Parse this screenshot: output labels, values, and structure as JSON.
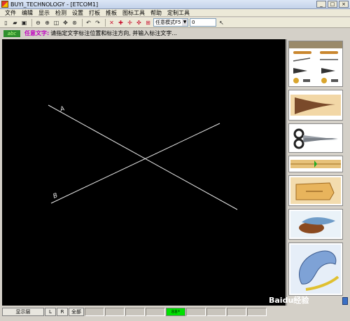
{
  "window": {
    "title": "BUYI_TECHNOLOGY - [ETCOM1]"
  },
  "menu": [
    "文件",
    "编辑",
    "显示",
    "检测",
    "设置",
    "打板",
    "推板",
    "图标工具",
    "帮助",
    "定制工具"
  ],
  "toolbar": {
    "mode_select": "任意模式F5",
    "value_input": "0"
  },
  "status": {
    "badge": "abc",
    "label": "任意文字:",
    "prompt": "请指定文字标注位置和标注方向, 并输入标注文字..."
  },
  "canvas": {
    "label_a": "A",
    "label_b": "B"
  },
  "bottom": {
    "layer": "显示层",
    "l": "L",
    "r": "R",
    "all": "全部",
    "indicator": "88*"
  },
  "watermark": "Baidu经验"
}
